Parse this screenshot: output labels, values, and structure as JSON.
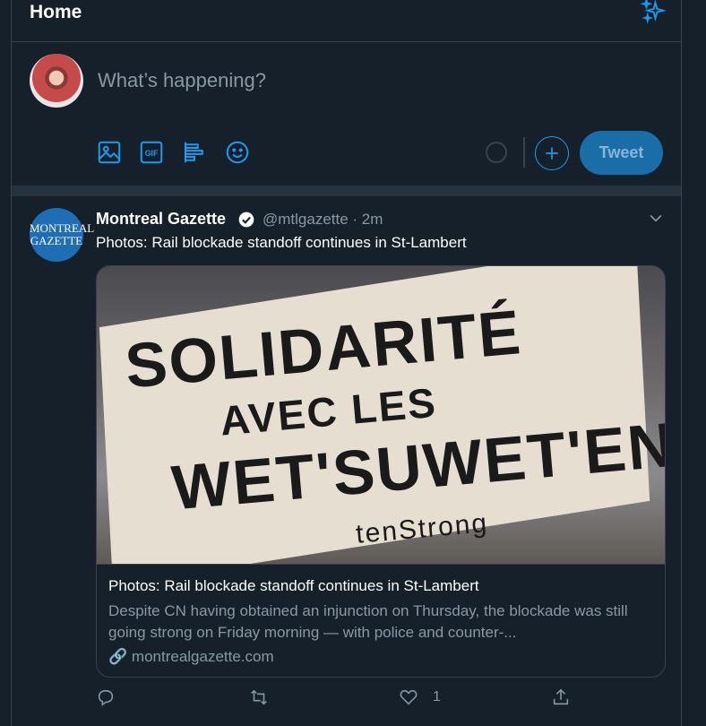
{
  "header": {
    "title": "Home",
    "icon": "sparkle-icon"
  },
  "composer": {
    "placeholder": "What’s happening?",
    "tools": [
      "image-icon",
      "gif-icon",
      "poll-icon",
      "emoji-icon"
    ],
    "gif_label": "GIF",
    "tweet_button": "Tweet"
  },
  "tweet": {
    "avatar_line1": "MONTREAL",
    "avatar_line2": "GAZETTE",
    "name": "Montreal Gazette",
    "handle_time": "@mtlgazette · 2m",
    "text": "Photos: Rail blockade standoff continues in St-Lambert",
    "card": {
      "image_text_line1": "SOLIDARITÉ",
      "image_text_line2": "AVEC LES",
      "image_text_line3": "WET'SUWET'EN",
      "image_text_line4": "tenStrong",
      "title": "Photos: Rail blockade standoff continues in St-Lambert",
      "description": "Despite CN having obtained an injunction on Thursday, the blockade was still going strong on Friday morning — with police and counter-...",
      "link": "montrealgazette.com"
    },
    "actions": {
      "like_count": "1"
    }
  },
  "colors": {
    "background": "#15202b",
    "accent": "#1d9bf0",
    "muted": "#8899a6",
    "border": "#38444d"
  }
}
